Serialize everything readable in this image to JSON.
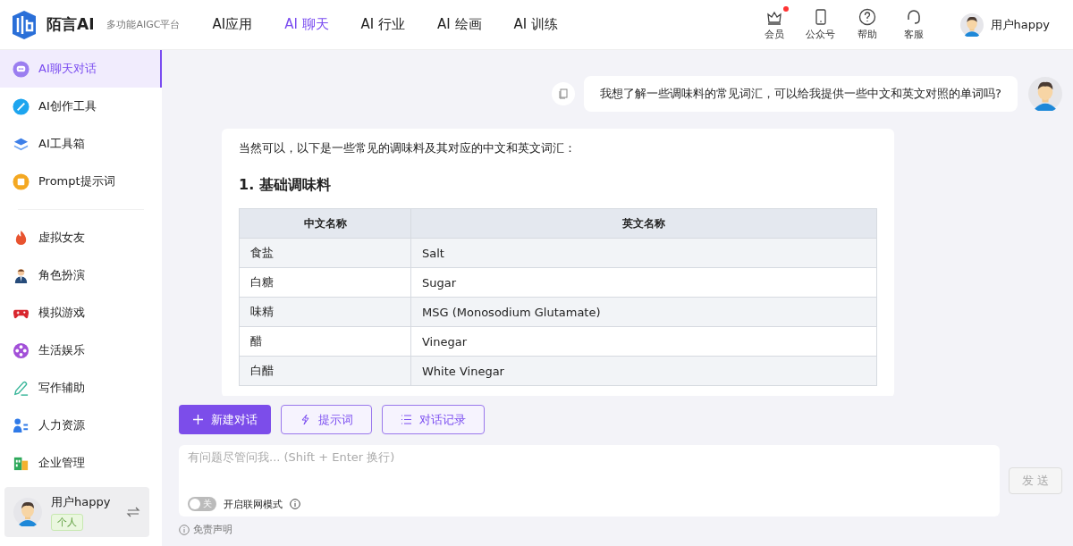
{
  "brand": {
    "name": "陌言AI",
    "tagline": "多功能AIGC平台"
  },
  "nav": [
    {
      "label": "AI应用",
      "selected": false
    },
    {
      "label": "AI 聊天",
      "selected": true
    },
    {
      "label": "AI 行业",
      "selected": false
    },
    {
      "label": "AI 绘画",
      "selected": false
    },
    {
      "label": "AI 训练",
      "selected": false
    }
  ],
  "header_actions": [
    {
      "label": "会员",
      "badge": true
    },
    {
      "label": "公众号",
      "badge": false
    },
    {
      "label": "帮助",
      "badge": false
    },
    {
      "label": "客服",
      "badge": false
    }
  ],
  "user": {
    "name": "用户happy"
  },
  "sidebar": {
    "groups": [
      [
        {
          "label": "AI聊天对话",
          "selected": true
        },
        {
          "label": "AI创作工具",
          "selected": false
        },
        {
          "label": "AI工具箱",
          "selected": false
        },
        {
          "label": "Prompt提示词",
          "selected": false
        }
      ],
      [
        {
          "label": "虚拟女友",
          "selected": false
        },
        {
          "label": "角色扮演",
          "selected": false
        },
        {
          "label": "模拟游戏",
          "selected": false
        },
        {
          "label": "生活娱乐",
          "selected": false
        },
        {
          "label": "写作辅助",
          "selected": false
        },
        {
          "label": "人力资源",
          "selected": false
        },
        {
          "label": "企业管理",
          "selected": false
        }
      ]
    ],
    "account": {
      "name": "用户happy",
      "tag": "个人"
    }
  },
  "chat": {
    "user_message": "我想了解一些调味料的常见词汇，可以给我提供一些中文和英文对照的单词吗?",
    "reply": {
      "intro": "当然可以，以下是一些常见的调味料及其对应的中文和英文词汇：",
      "heading": "1. 基础调味料",
      "table": {
        "columns": [
          "中文名称",
          "英文名称"
        ],
        "rows": [
          [
            "食盐",
            "Salt"
          ],
          [
            "白糖",
            "Sugar"
          ],
          [
            "味精",
            "MSG (Monosodium Glutamate)"
          ],
          [
            "醋",
            "Vinegar"
          ],
          [
            "白醋",
            "White Vinegar"
          ]
        ]
      }
    }
  },
  "actions": [
    {
      "label": "新建对话",
      "kind": "primary"
    },
    {
      "label": "提示词",
      "kind": "outline"
    },
    {
      "label": "对话记录",
      "kind": "outline"
    }
  ],
  "composer": {
    "placeholder": "有问题尽管问我... (Shift + Enter 换行)",
    "web_toggle": {
      "on": false,
      "state_label": "关",
      "label": "开启联网模式"
    },
    "send": "发 送"
  },
  "disclaimer": "免责声明"
}
